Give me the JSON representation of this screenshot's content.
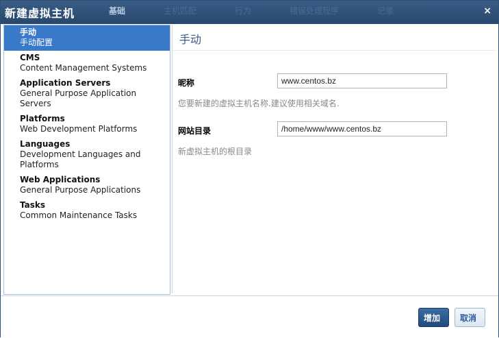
{
  "dialog": {
    "title": "新建虚拟主机",
    "bg_tabs": [
      "基础",
      "主机匹配",
      "行为",
      "错误处理程序",
      "记录"
    ],
    "close_label": "×"
  },
  "sidebar": {
    "items": [
      {
        "name": "手动",
        "desc": "手动配置",
        "selected": true
      },
      {
        "name": "CMS",
        "desc": "Content Management Systems"
      },
      {
        "name": "Application Servers",
        "desc": "General Purpose Application Servers"
      },
      {
        "name": "Platforms",
        "desc": "Web Development Platforms"
      },
      {
        "name": "Languages",
        "desc": "Development Languages and Platforms"
      },
      {
        "name": "Web Applications",
        "desc": "General Purpose Applications"
      },
      {
        "name": "Tasks",
        "desc": "Common Maintenance Tasks"
      }
    ]
  },
  "main": {
    "title": "手动",
    "nickname": {
      "label": "昵称",
      "value": "www.centos.bz",
      "hint": "您要新建的虚拟主机名称.建议使用相关域名."
    },
    "docroot": {
      "label": "网站目录",
      "value": "/home/www/www.centos.bz",
      "hint": "新虚拟主机的根目录"
    }
  },
  "footer": {
    "add_label": "增加",
    "cancel_label": "取消"
  }
}
